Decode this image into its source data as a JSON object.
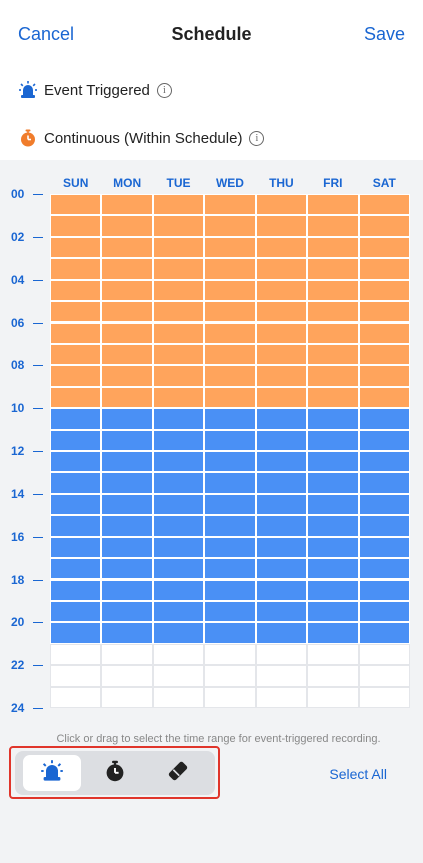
{
  "nav": {
    "cancel": "Cancel",
    "title": "Schedule",
    "save": "Save"
  },
  "legend": {
    "event": "Event Triggered",
    "continuous": "Continuous (Within Schedule)",
    "info_glyph": "i"
  },
  "days": [
    "SUN",
    "MON",
    "TUE",
    "WED",
    "THU",
    "FRI",
    "SAT"
  ],
  "hours": [
    "00",
    "02",
    "04",
    "06",
    "08",
    "10",
    "12",
    "14",
    "16",
    "18",
    "20",
    "22",
    "24"
  ],
  "schedule": {
    "slots_per_day": 24,
    "continuous_hours": [
      0,
      10
    ],
    "event_hours": [
      10,
      21
    ],
    "empty_hours": [
      21,
      24
    ]
  },
  "colors": {
    "continuous": "#ffa45c",
    "event": "#4a90f5",
    "empty": "#ffffff",
    "accent": "#1a66d2",
    "highlight": "#e0352b"
  },
  "hint": "Click or drag to select the time range for event-triggered recording.",
  "modes": [
    {
      "name": "event-mode-button",
      "icon": "alarm-icon",
      "selected": true
    },
    {
      "name": "continuous-mode-button",
      "icon": "stopwatch-icon",
      "selected": false
    },
    {
      "name": "eraser-mode-button",
      "icon": "eraser-icon",
      "selected": false
    }
  ],
  "select_all": "Select All"
}
